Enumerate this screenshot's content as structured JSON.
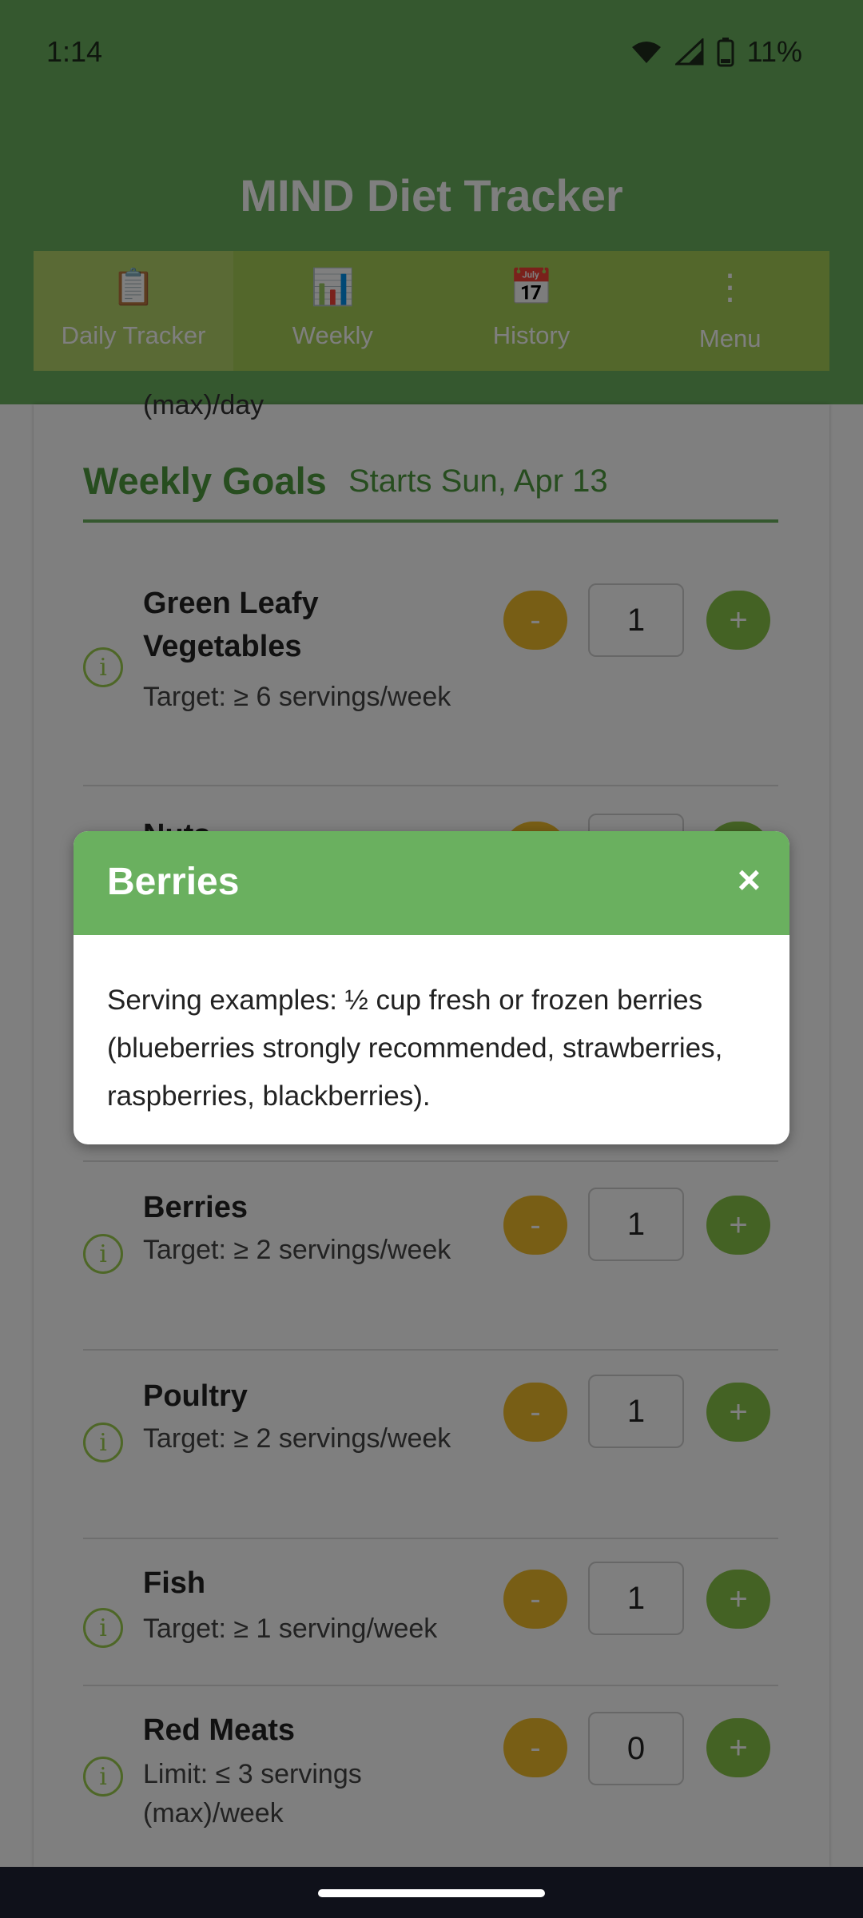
{
  "status": {
    "time": "1:14",
    "battery": "11%"
  },
  "header": {
    "title": "MIND Diet Tracker"
  },
  "tabs": [
    {
      "icon": "📋",
      "label": "Daily Tracker"
    },
    {
      "icon": "📊",
      "label": "Weekly"
    },
    {
      "icon": "📅",
      "label": "History"
    },
    {
      "icon": "⋮",
      "label": "Menu"
    }
  ],
  "prev_item_text": "(max)/day",
  "section": {
    "title": "Weekly Goals",
    "subtitle": "Starts Sun, Apr 13"
  },
  "items": [
    {
      "name": "Green Leafy Vegetables",
      "target": "Target: ≥ 6 servings/week",
      "count": "1"
    },
    {
      "name": "Nuts",
      "target": "",
      "count": ""
    },
    {
      "name": "Berries",
      "target": "Target: ≥ 2 servings/week",
      "count": "1"
    },
    {
      "name": "Poultry",
      "target": "Target: ≥ 2 servings/week",
      "count": "1"
    },
    {
      "name": "Fish",
      "target": "Target: ≥ 1 serving/week",
      "count": "1"
    },
    {
      "name": "Red Meats",
      "target": "Limit: ≤ 3 servings (max)/week",
      "count": "0"
    }
  ],
  "buttons": {
    "minus": "-",
    "plus": "+",
    "info": "i"
  },
  "modal": {
    "title": "Berries",
    "close": "×",
    "body": "Serving examples: ½ cup fresh or frozen berries (blueberries strongly recommended, strawberries, raspberries, blackberries)."
  },
  "colors": {
    "primary": "#6ab05f",
    "minus": "#f0bc2a",
    "plus": "#89c448",
    "tab_bar": "#a6cf57"
  }
}
